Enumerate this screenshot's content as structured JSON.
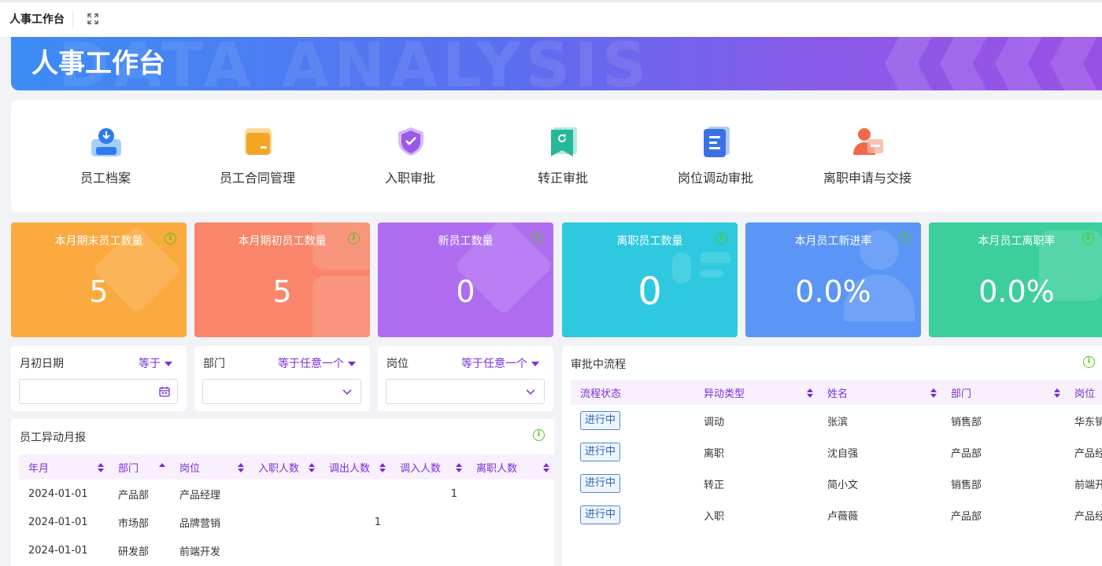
{
  "topbar": {
    "title": "人事工作台"
  },
  "banner": {
    "title": "人事工作台",
    "watermark": "DATA ANALYSIS"
  },
  "quick": [
    {
      "label": "员工档案",
      "icon": "employee-file-icon",
      "color": "#2f7ce8"
    },
    {
      "label": "员工合同管理",
      "icon": "contract-folder-icon",
      "color": "#f2a623"
    },
    {
      "label": "入职审批",
      "icon": "shield-check-icon",
      "color": "#9b59e6"
    },
    {
      "label": "转正审批",
      "icon": "bookmark-icon",
      "color": "#27b89a"
    },
    {
      "label": "岗位调动审批",
      "icon": "document-icon",
      "color": "#3a72e6"
    },
    {
      "label": "离职申请与交接",
      "icon": "user-leave-icon",
      "color": "#f06a4a"
    }
  ],
  "stats": [
    {
      "title": "本月期末员工数量",
      "value": "5",
      "color": "#fbaa40"
    },
    {
      "title": "本月期初员工数量",
      "value": "5",
      "color": "#f9866a"
    },
    {
      "title": "新员工数量",
      "value": "0",
      "color": "#b06cf1"
    },
    {
      "title": "离职员工数量",
      "value": "0",
      "color": "#2ec9df"
    },
    {
      "title": "本月员工新进率",
      "value": "0.0%",
      "color": "#5b96f6"
    },
    {
      "title": "本月员工离职率",
      "value": "0.0%",
      "color": "#3ccf9c"
    }
  ],
  "filters": [
    {
      "label": "月初日期",
      "op": "等于",
      "input": "date"
    },
    {
      "label": "部门",
      "op": "等于任意一个",
      "input": "select"
    },
    {
      "label": "岗位",
      "op": "等于任意一个",
      "input": "select"
    }
  ],
  "monthly": {
    "title": "员工异动月报",
    "columns": [
      "年月",
      "部门",
      "岗位",
      "入职人数",
      "调出人数",
      "调入人数",
      "离职人数"
    ],
    "rows": [
      [
        "2024-01-01",
        "产品部",
        "产品经理",
        "",
        "",
        "1",
        ""
      ],
      [
        "2024-01-01",
        "市场部",
        "品牌营销",
        "",
        "1",
        "",
        ""
      ],
      [
        "2024-01-01",
        "研发部",
        "前端开发",
        "",
        "",
        "",
        ""
      ]
    ]
  },
  "process": {
    "title": "审批中流程",
    "columns": [
      "流程状态",
      "异动类型",
      "姓名",
      "部门",
      "岗位"
    ],
    "rows": [
      [
        "进行中",
        "调动",
        "张滨",
        "销售部",
        "华东销"
      ],
      [
        "进行中",
        "离职",
        "沈自强",
        "产品部",
        "产品经"
      ],
      [
        "进行中",
        "转正",
        "简小文",
        "销售部",
        "前端开"
      ],
      [
        "进行中",
        "入职",
        "卢薇薇",
        "产品部",
        "产品经"
      ]
    ]
  },
  "info_glyph": "i"
}
